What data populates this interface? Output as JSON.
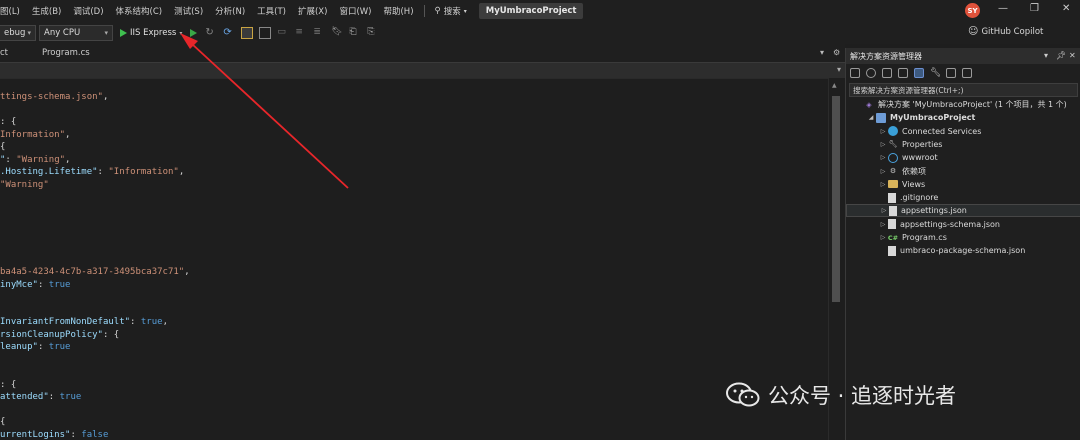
{
  "menubar": {
    "items": [
      "图(L)",
      "生成(B)",
      "调试(D)",
      "体系结构(C)",
      "测试(S)",
      "分析(N)",
      "工具(T)",
      "扩展(X)",
      "窗口(W)",
      "帮助(H)"
    ],
    "search_label": "搜索",
    "project_title": "MyUmbracoProject",
    "avatar_initials": "SY"
  },
  "toolbar": {
    "config": "ebug",
    "platform": "Any CPU",
    "run_label": "IIS Express",
    "copilot_label": "GitHub Copilot"
  },
  "tabs": [
    {
      "label": "ct"
    },
    {
      "label": "Program.cs"
    }
  ],
  "code": {
    "lines": [
      {
        "parts": [
          {
            "t": "ttings-schema.json\"",
            "c": "s"
          },
          {
            "t": ",",
            "c": "p"
          }
        ]
      },
      {
        "parts": []
      },
      {
        "parts": [
          {
            "t": ": {",
            "c": "p"
          }
        ]
      },
      {
        "parts": [
          {
            "t": "Information\"",
            "c": "s"
          },
          {
            "t": ",",
            "c": "p"
          }
        ]
      },
      {
        "parts": [
          {
            "t": "{",
            "c": "p"
          }
        ]
      },
      {
        "parts": [
          {
            "t": "\"",
            "c": "k"
          },
          {
            "t": ": ",
            "c": "p"
          },
          {
            "t": "\"Warning\"",
            "c": "s"
          },
          {
            "t": ",",
            "c": "p"
          }
        ]
      },
      {
        "parts": [
          {
            "t": ".Hosting.Lifetime\"",
            "c": "k"
          },
          {
            "t": ": ",
            "c": "p"
          },
          {
            "t": "\"Information\"",
            "c": "s"
          },
          {
            "t": ",",
            "c": "p"
          }
        ]
      },
      {
        "parts": [
          {
            "t": "\"Warning\"",
            "c": "s"
          }
        ]
      },
      {
        "parts": []
      },
      {
        "parts": []
      },
      {
        "parts": []
      },
      {
        "parts": []
      },
      {
        "parts": []
      },
      {
        "parts": []
      },
      {
        "parts": [
          {
            "t": "ba4a5-4234-4c7b-a317-3495bca37c71\"",
            "c": "s"
          },
          {
            "t": ",",
            "c": "p"
          }
        ]
      },
      {
        "parts": [
          {
            "t": "inyMce\"",
            "c": "k"
          },
          {
            "t": ": ",
            "c": "p"
          },
          {
            "t": "true",
            "c": "b"
          }
        ]
      },
      {
        "parts": []
      },
      {
        "parts": []
      },
      {
        "parts": [
          {
            "t": "InvariantFromNonDefault\"",
            "c": "k"
          },
          {
            "t": ": ",
            "c": "p"
          },
          {
            "t": "true",
            "c": "b"
          },
          {
            "t": ",",
            "c": "p"
          }
        ]
      },
      {
        "parts": [
          {
            "t": "rsionCleanupPolicy\"",
            "c": "k"
          },
          {
            "t": ": {",
            "c": "p"
          }
        ]
      },
      {
        "parts": [
          {
            "t": "leanup\"",
            "c": "k"
          },
          {
            "t": ": ",
            "c": "p"
          },
          {
            "t": "true",
            "c": "b"
          }
        ]
      },
      {
        "parts": []
      },
      {
        "parts": []
      },
      {
        "parts": [
          {
            "t": ": {",
            "c": "p"
          }
        ]
      },
      {
        "parts": [
          {
            "t": "attended\"",
            "c": "k"
          },
          {
            "t": ": ",
            "c": "p"
          },
          {
            "t": "true",
            "c": "b"
          }
        ]
      },
      {
        "parts": []
      },
      {
        "parts": [
          {
            "t": "{",
            "c": "p"
          }
        ]
      },
      {
        "parts": [
          {
            "t": "urrentLogins\"",
            "c": "k"
          },
          {
            "t": ": ",
            "c": "p"
          },
          {
            "t": "false",
            "c": "b"
          }
        ]
      }
    ]
  },
  "solution_explorer": {
    "title": "解决方案资源管理器",
    "search_placeholder": "搜索解决方案资源管理器(Ctrl+;)",
    "items": [
      {
        "label": "解决方案 'MyUmbracoProject' (1 个项目，共 1 个)",
        "icon": "solution-icon",
        "indent": 0,
        "expand": "",
        "bold": false
      },
      {
        "label": "MyUmbracoProject",
        "icon": "project-icon",
        "indent": 1,
        "expand": "open",
        "bold": true
      },
      {
        "label": "Connected Services",
        "icon": "connected-services-icon",
        "indent": 2,
        "expand": "closed",
        "bold": false
      },
      {
        "label": "Properties",
        "icon": "properties-icon",
        "indent": 2,
        "expand": "closed",
        "bold": false
      },
      {
        "label": "wwwroot",
        "icon": "globe-icon",
        "indent": 2,
        "expand": "closed",
        "bold": false
      },
      {
        "label": "依赖项",
        "icon": "dependencies-icon",
        "indent": 2,
        "expand": "closed",
        "bold": false
      },
      {
        "label": "Views",
        "icon": "folder-icon",
        "indent": 2,
        "expand": "closed",
        "bold": false
      },
      {
        "label": ".gitignore",
        "icon": "file-icon",
        "indent": 2,
        "expand": "",
        "bold": false
      },
      {
        "label": "appsettings.json",
        "icon": "json-file-icon",
        "indent": 2,
        "expand": "closed",
        "bold": false,
        "selected": true
      },
      {
        "label": "appsettings-schema.json",
        "icon": "json-file-icon",
        "indent": 2,
        "expand": "closed",
        "bold": false
      },
      {
        "label": "Program.cs",
        "icon": "csharp-file-icon",
        "indent": 2,
        "expand": "closed",
        "bold": false
      },
      {
        "label": "umbraco-package-schema.json",
        "icon": "json-file-icon",
        "indent": 2,
        "expand": "",
        "bold": false
      }
    ]
  },
  "watermark": {
    "text": "公众号 · 追逐时光者"
  },
  "colors": {
    "annotation_arrow": "#e8262a",
    "run_green": "#3fbf4f"
  }
}
